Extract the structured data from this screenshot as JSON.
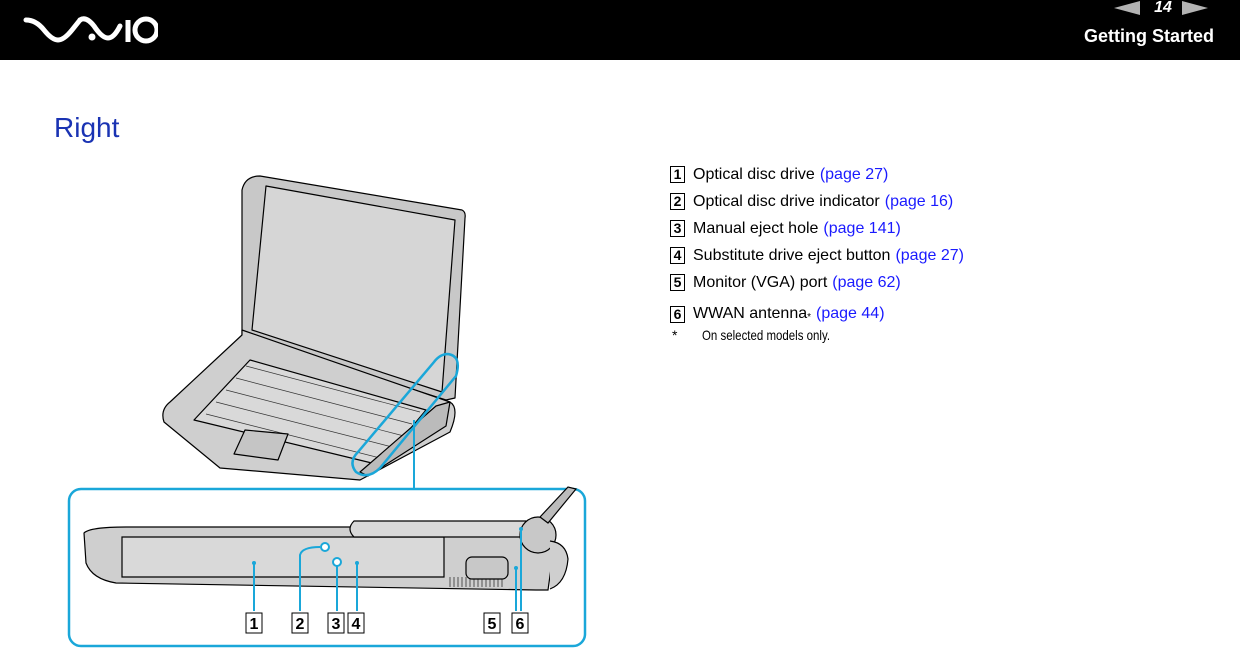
{
  "header": {
    "brand": "VAIO",
    "page_number": "14",
    "section": "Getting Started",
    "prev_icon": "arrow-left-icon",
    "next_icon": "arrow-right-icon"
  },
  "page_heading": "Right",
  "legend": [
    {
      "num": "1",
      "label": "Optical disc drive",
      "link": "(page 27)"
    },
    {
      "num": "2",
      "label": "Optical disc drive indicator",
      "link": "(page 16)"
    },
    {
      "num": "3",
      "label": "Manual eject hole",
      "link": "(page 141)"
    },
    {
      "num": "4",
      "label": "Substitute drive eject button",
      "link": "(page 27)"
    },
    {
      "num": "5",
      "label": "Monitor (VGA) port",
      "link": "(page 62)"
    },
    {
      "num": "6",
      "label": "WWAN antenna",
      "sup": "*",
      "link": "(page 44)"
    }
  ],
  "footnote": {
    "mark": "*",
    "text": "On selected models only."
  },
  "diagram": {
    "callout_labels": [
      "1",
      "2",
      "3",
      "4",
      "5",
      "6"
    ],
    "accent_color": "#1aa7d9"
  }
}
